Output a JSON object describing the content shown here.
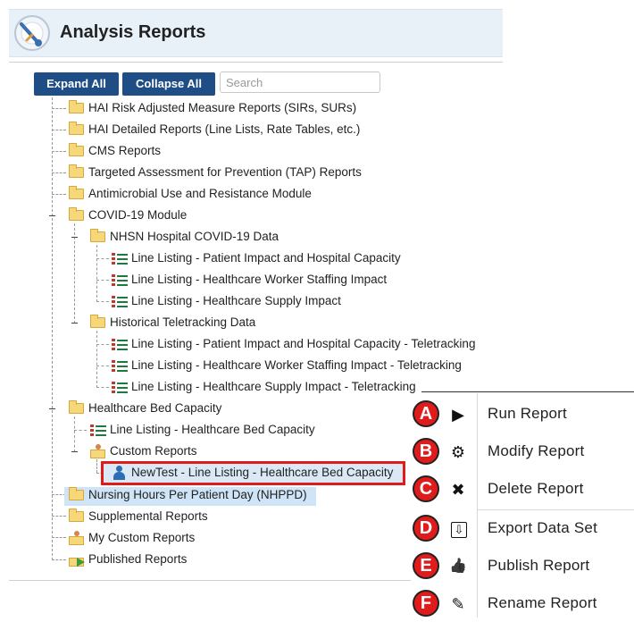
{
  "header": {
    "title": "Analysis Reports"
  },
  "toolbar": {
    "expand_all": "Expand All",
    "collapse_all": "Collapse All",
    "search_placeholder": "Search"
  },
  "tree": [
    {
      "label": "HAI Risk Adjusted Measure Reports (SIRs, SURs)"
    },
    {
      "label": "HAI Detailed Reports (Line Lists, Rate Tables, etc.)"
    },
    {
      "label": "CMS Reports"
    },
    {
      "label": "Targeted Assessment for Prevention (TAP) Reports"
    },
    {
      "label": "Antimicrobial Use and Resistance Module"
    },
    {
      "label": "COVID-19 Module"
    },
    {
      "label": "NHSN Hospital COVID-19 Data"
    },
    {
      "label": "Line Listing - Patient Impact and Hospital Capacity"
    },
    {
      "label": "Line Listing - Healthcare Worker Staffing Impact"
    },
    {
      "label": "Line Listing - Healthcare Supply Impact"
    },
    {
      "label": "Historical Teletracking Data"
    },
    {
      "label": "Line Listing - Patient Impact and Hospital Capacity - Teletracking"
    },
    {
      "label": "Line Listing - Healthcare Worker Staffing Impact - Teletracking"
    },
    {
      "label": "Line Listing - Healthcare Supply Impact - Teletracking"
    },
    {
      "label": "Healthcare Bed Capacity"
    },
    {
      "label": "Line Listing - Healthcare Bed Capacity"
    },
    {
      "label": "Custom Reports"
    },
    {
      "label": "NewTest - Line Listing - Healthcare Bed Capacity"
    },
    {
      "label": "Nursing Hours Per Patient Day (NHPPD)"
    },
    {
      "label": "Supplemental Reports"
    },
    {
      "label": "My Custom Reports"
    },
    {
      "label": "Published Reports"
    }
  ],
  "context_menu": [
    {
      "badge": "A",
      "icon": "play-icon",
      "glyph": "▶",
      "label": "Run Report"
    },
    {
      "badge": "B",
      "icon": "gear-icon",
      "glyph": "⚙",
      "label": "Modify Report"
    },
    {
      "badge": "C",
      "icon": "close-icon",
      "glyph": "✖",
      "label": "Delete Report"
    },
    {
      "badge": "D",
      "icon": "export-icon",
      "glyph": "⇩",
      "label": "Export Data Set"
    },
    {
      "badge": "E",
      "icon": "thumbs-up-icon",
      "glyph": "👍",
      "label": "Publish Report"
    },
    {
      "badge": "F",
      "icon": "pencil-icon",
      "glyph": "✎",
      "label": "Rename Report"
    }
  ],
  "colors": {
    "button_bg": "#1f4e87",
    "badge_red": "#e01b1b",
    "selection_bg": "#dbe9f6"
  }
}
